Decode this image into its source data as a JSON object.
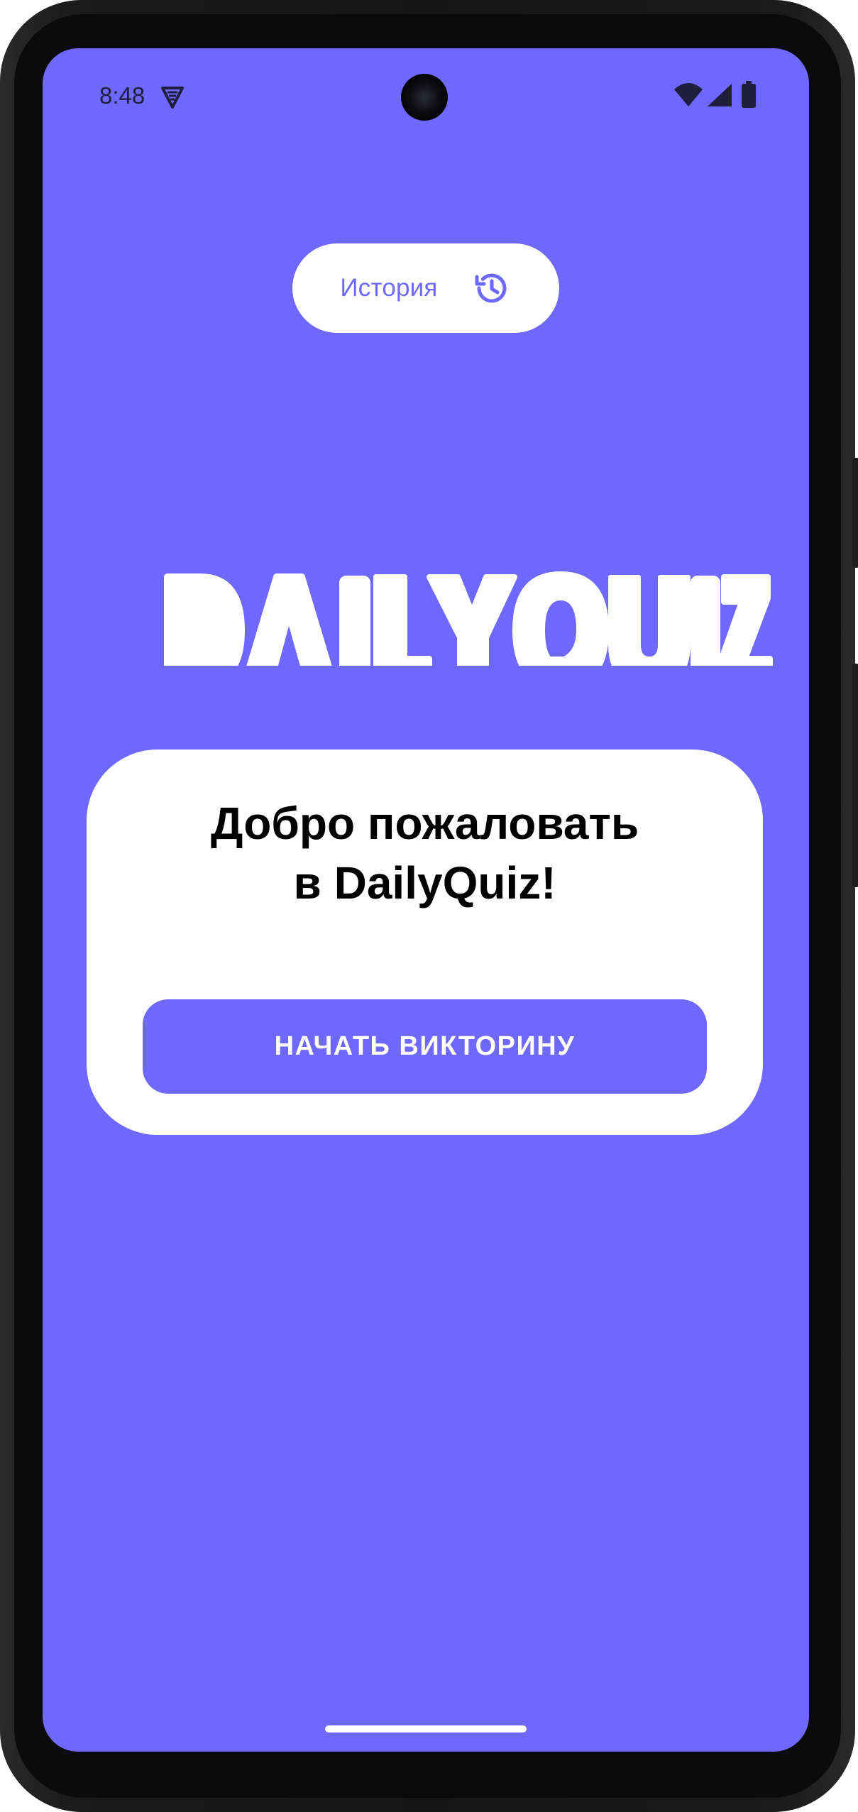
{
  "status_bar": {
    "time": "8:48",
    "icons": [
      "vpn-shield-icon",
      "wifi-icon",
      "cellular-signal-icon",
      "battery-icon"
    ]
  },
  "history_button": {
    "label": "История",
    "icon": "history-icon"
  },
  "logo": {
    "text": "DAILYQUIZ"
  },
  "welcome_card": {
    "title_line1": "Добро пожаловать",
    "title_line2": "в DailyQuiz!",
    "start_button_label": "НАЧАТЬ ВИКТОРИНУ"
  },
  "colors": {
    "background": "#6f68fd",
    "accent": "#6f68fd",
    "card": "#ffffff",
    "title_text": "#000000",
    "status_text": "#1f1f3d"
  }
}
